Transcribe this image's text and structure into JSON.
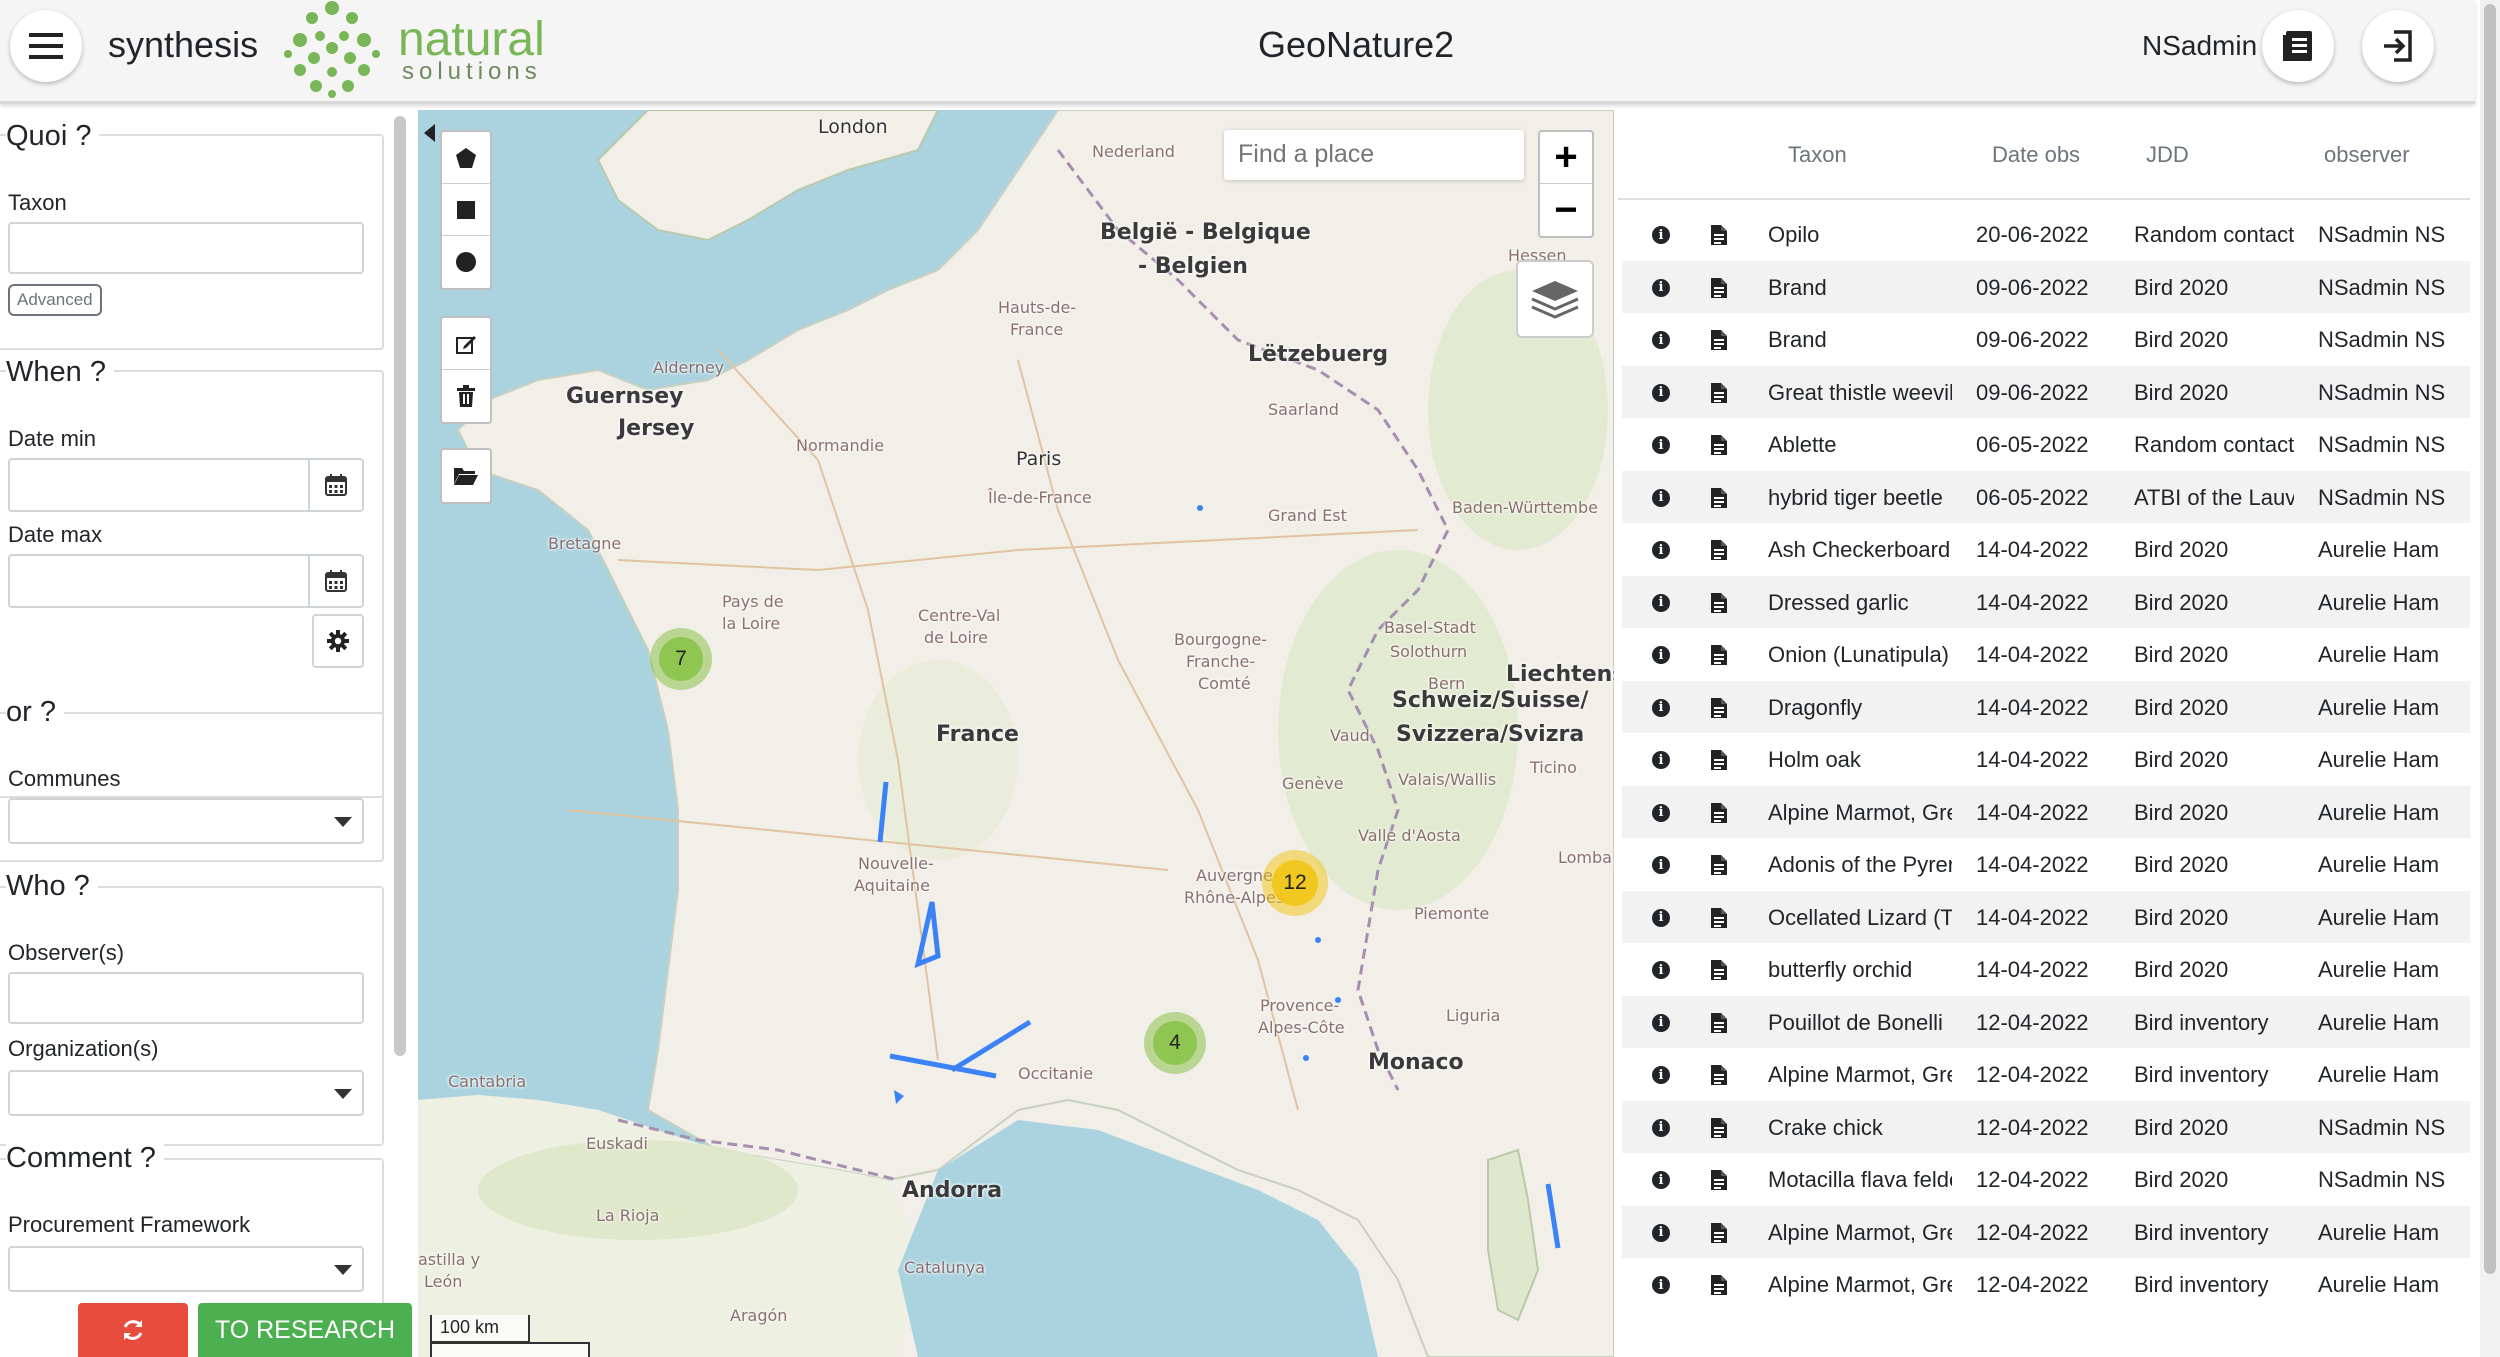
{
  "header": {
    "app_name": "synthesis",
    "logo_word1": "natural",
    "logo_word2": "solutions",
    "title": "GeoNature2",
    "user": "NSadmin"
  },
  "filters": {
    "what": {
      "legend": "Quoi ?",
      "taxon_label": "Taxon",
      "taxon_value": "",
      "advanced_label": "Advanced"
    },
    "when": {
      "legend": "When ?",
      "date_min_label": "Date min",
      "date_min_value": "",
      "date_max_label": "Date max",
      "date_max_value": ""
    },
    "where": {
      "legend": "or ?",
      "communes_label": "Communes",
      "communes_value": ""
    },
    "who": {
      "legend": "Who ?",
      "observers_label": "Observer(s)",
      "observers_value": "",
      "organization_label": "Organization(s)",
      "organization_value": ""
    },
    "comment": {
      "legend": "Comment ?",
      "procurement_label": "Procurement Framework",
      "procurement_value": ""
    },
    "research_label": "TO RESEARCH"
  },
  "map": {
    "search_placeholder": "Find a place",
    "zoom_in": "+",
    "zoom_out": "−",
    "scale_label": "100 km",
    "clusters": [
      {
        "count": "7"
      },
      {
        "count": "12"
      },
      {
        "count": "4"
      }
    ],
    "labels": {
      "london": "London",
      "belgique": "België - Belgique",
      "belgien": "- Belgien",
      "letzebuerg": "Lëtzebuerg",
      "guernsey": "Guernsey",
      "jersey": "Jersey",
      "paris": "Paris",
      "france": "France",
      "liechtenstein": "Liechtens",
      "schweiz": "Schweiz/Suisse/",
      "svizzera": "Svizzera/Svizra",
      "monaco": "Monaco",
      "andorra": "Andorra",
      "bretagne": "Bretagne",
      "normandie": "Normandie",
      "pays_de_loire": "Pays de",
      "la_loire": "la Loire",
      "centre": "Centre-Val",
      "de_loire": "de Loire",
      "nouvelle": "Nouvelle-",
      "aquitaine": "Aquitaine",
      "auvergne": "Auvergne-",
      "rhone": "Rhône-Alpes",
      "occitanie": "Occitanie",
      "provence": "Provence-",
      "alpes_cote": "Alpes-Côte",
      "grand_est": "Grand Est",
      "bourgogne": "Bourgogne-",
      "franche": "Franche-",
      "comte": "Comté",
      "hauts": "Hauts-de-",
      "hauts2": "France",
      "ile": "Île-de-France",
      "nederland": "Nederland",
      "baden": "Baden-Württembe",
      "piemonte": "Piemonte",
      "catalunya": "Catalunya",
      "euskadi": "Euskadi",
      "aragon": "Aragón",
      "cantabria": "Cantabria",
      "la_rioja": "La Rioja",
      "liguria": "Liguria",
      "vaud": "Vaud",
      "geneve": "Genève",
      "valais": "Valais/Wallis",
      "aosta": "Valle d'Aosta",
      "lombardia": "Lomba",
      "ticino": "Ticino",
      "alderney": "Alderney",
      "solothurn": "Solothurn",
      "hessen": "Hessen",
      "saarland": "Saarland",
      "bern": "Bern",
      "basel": "Basel-Stadt",
      "castilla": "astilla y",
      "leon": "León",
      "france_dup": "France"
    }
  },
  "table": {
    "columns": [
      "Taxon",
      "Date obs",
      "JDD",
      "observer"
    ],
    "rows": [
      {
        "taxon": "Opilo",
        "date": "20-06-2022",
        "jdd": "Random contact",
        "observer": "NSadmin NS"
      },
      {
        "taxon": "Brand",
        "date": "09-06-2022",
        "jdd": "Bird 2020",
        "observer": "NSadmin NS"
      },
      {
        "taxon": "Brand",
        "date": "09-06-2022",
        "jdd": "Bird 2020",
        "observer": "NSadmin NS"
      },
      {
        "taxon": "Great thistle weevil",
        "date": "09-06-2022",
        "jdd": "Bird 2020",
        "observer": "NSadmin NS"
      },
      {
        "taxon": "Ablette",
        "date": "06-05-2022",
        "jdd": "Random contact",
        "observer": "NSadmin NS"
      },
      {
        "taxon": "hybrid tiger beetle",
        "date": "06-05-2022",
        "jdd": "ATBI of the Lauvitel",
        "observer": "NSadmin NS"
      },
      {
        "taxon": "Ash Checkerboard",
        "date": "14-04-2022",
        "jdd": "Bird 2020",
        "observer": "Aurelie Ham"
      },
      {
        "taxon": "Dressed garlic",
        "date": "14-04-2022",
        "jdd": "Bird 2020",
        "observer": "Aurelie Ham"
      },
      {
        "taxon": "Onion (Lunatipula)",
        "date": "14-04-2022",
        "jdd": "Bird 2020",
        "observer": "Aurelie Ham"
      },
      {
        "taxon": "Dragonfly",
        "date": "14-04-2022",
        "jdd": "Bird 2020",
        "observer": "Aurelie Ham"
      },
      {
        "taxon": "Holm oak",
        "date": "14-04-2022",
        "jdd": "Bird 2020",
        "observer": "Aurelie Ham"
      },
      {
        "taxon": "Alpine Marmot, Grey",
        "date": "14-04-2022",
        "jdd": "Bird 2020",
        "observer": "Aurelie Ham"
      },
      {
        "taxon": "Adonis of the Pyrenees",
        "date": "14-04-2022",
        "jdd": "Bird 2020",
        "observer": "Aurelie Ham"
      },
      {
        "taxon": "Ocellated Lizard (T",
        "date": "14-04-2022",
        "jdd": "Bird 2020",
        "observer": "Aurelie Ham"
      },
      {
        "taxon": "butterfly orchid",
        "date": "14-04-2022",
        "jdd": "Bird 2020",
        "observer": "Aurelie Ham"
      },
      {
        "taxon": "Pouillot de Bonelli",
        "date": "12-04-2022",
        "jdd": "Bird inventory",
        "observer": "Aurelie Ham"
      },
      {
        "taxon": "Alpine Marmot, Grey",
        "date": "12-04-2022",
        "jdd": "Bird inventory",
        "observer": "Aurelie Ham"
      },
      {
        "taxon": "Crake chick",
        "date": "12-04-2022",
        "jdd": "Bird 2020",
        "observer": "NSadmin NS"
      },
      {
        "taxon": "Motacilla flava feldegg",
        "date": "12-04-2022",
        "jdd": "Bird 2020",
        "observer": "NSadmin NS"
      },
      {
        "taxon": "Alpine Marmot, Grey",
        "date": "12-04-2022",
        "jdd": "Bird inventory",
        "observer": "Aurelie Ham"
      },
      {
        "taxon": "Alpine Marmot, Grey",
        "date": "12-04-2022",
        "jdd": "Bird inventory",
        "observer": "Aurelie Ham"
      }
    ]
  },
  "colors": {
    "reset_button": "#e74c3c",
    "research_button": "#4caf50",
    "cluster_green": "#8bc34a",
    "cluster_yellow": "#f1c40f",
    "geometry_blue": "#3b82f6",
    "logo_green": "#79b657"
  },
  "icons": {
    "menu": "hamburger-icon",
    "docs": "book-icon",
    "logout": "logout-icon",
    "calendar": "calendar-icon",
    "settings": "gear-icon",
    "reset": "refresh-icon",
    "info": "info-icon",
    "file": "file-icon",
    "layers": "layers-icon"
  }
}
